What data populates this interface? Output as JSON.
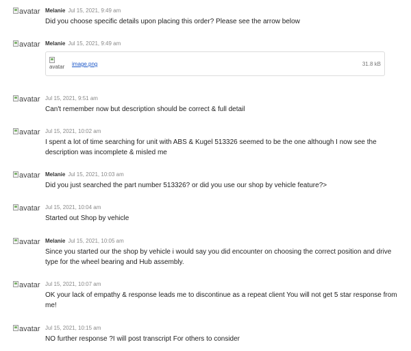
{
  "avatar_alt": "avatar",
  "messages": [
    {
      "author": "Melanie",
      "time": "Jul 15, 2021, 9:49 am",
      "text": "Did you choose specific details upon placing this order? Please see the arrow below"
    },
    {
      "author": "Melanie",
      "time": "Jul 15, 2021, 9:49 am",
      "attachment": {
        "name": "image.png",
        "size": "31.8 kB"
      }
    },
    {
      "author": "",
      "time": "Jul 15, 2021, 9:51 am",
      "text": "Can't remember now but description should be correct & full detail"
    },
    {
      "author": "",
      "time": "Jul 15, 2021, 10:02 am",
      "text": "I spent a lot of time searching for unit with ABS & Kugel 513326 seemed to be the one although I now see the description was incomplete & misled me"
    },
    {
      "author": "Melanie",
      "time": "Jul 15, 2021, 10:03 am",
      "text": "Did you just searched the part number 513326? or did you use our shop by vehicle feature?>"
    },
    {
      "author": "",
      "time": "Jul 15, 2021, 10:04 am",
      "text": "Started out Shop by vehicle"
    },
    {
      "author": "Melanie",
      "time": "Jul 15, 2021, 10:05 am",
      "text": "Since you started our the shop by vehicle i would say you did encounter on choosing the correct position and drive type for the wheel bearing and Hub assembly."
    },
    {
      "author": "",
      "time": "Jul 15, 2021, 10:07 am",
      "text": "OK your lack of empathy & response leads me to discontinue as a repeat client You will not get 5 star response from me!"
    },
    {
      "author": "",
      "time": "Jul 15, 2021, 10:15 am",
      "text": "NO further response ?I will post transcript For others to consider"
    }
  ]
}
